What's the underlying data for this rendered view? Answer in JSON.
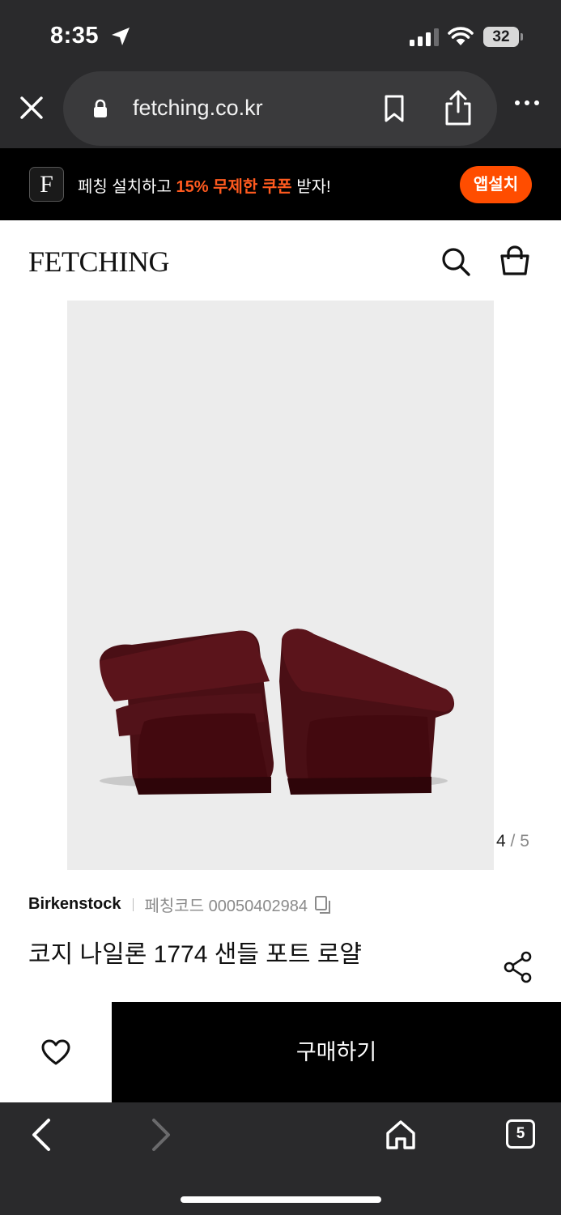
{
  "status_bar": {
    "time": "8:35",
    "battery": "32"
  },
  "browser": {
    "url": "fetching.co.kr",
    "open_tabs": "5"
  },
  "app_banner": {
    "logo_letter": "F",
    "text_before": "페칭 설치하고 ",
    "text_accent": "15% 무제한 쿠폰",
    "text_after": " 받자!",
    "install_label": "앱설치",
    "accent_color": "#ff4d00"
  },
  "header": {
    "logo": "FETCHING"
  },
  "product": {
    "image_counter_current": "4",
    "image_counter_sep": " / ",
    "image_counter_total": "5",
    "brand": "Birkenstock",
    "code_label": "페칭코드 00050402984",
    "title": "코지 나일론 1774 샌들 포트 로얄"
  },
  "purchase_bar": {
    "buy_label": "구매하기"
  },
  "icons": {
    "close": "close-icon",
    "lock": "lock-icon",
    "bookmark": "bookmark-icon",
    "share": "share-icon",
    "more": "more-icon",
    "search": "search-icon",
    "bag": "shopping-bag-icon",
    "copy": "copy-icon",
    "share_nodes": "share-nodes-icon",
    "heart": "heart-icon",
    "back": "chevron-left-icon",
    "forward": "chevron-right-icon",
    "home": "home-icon"
  }
}
